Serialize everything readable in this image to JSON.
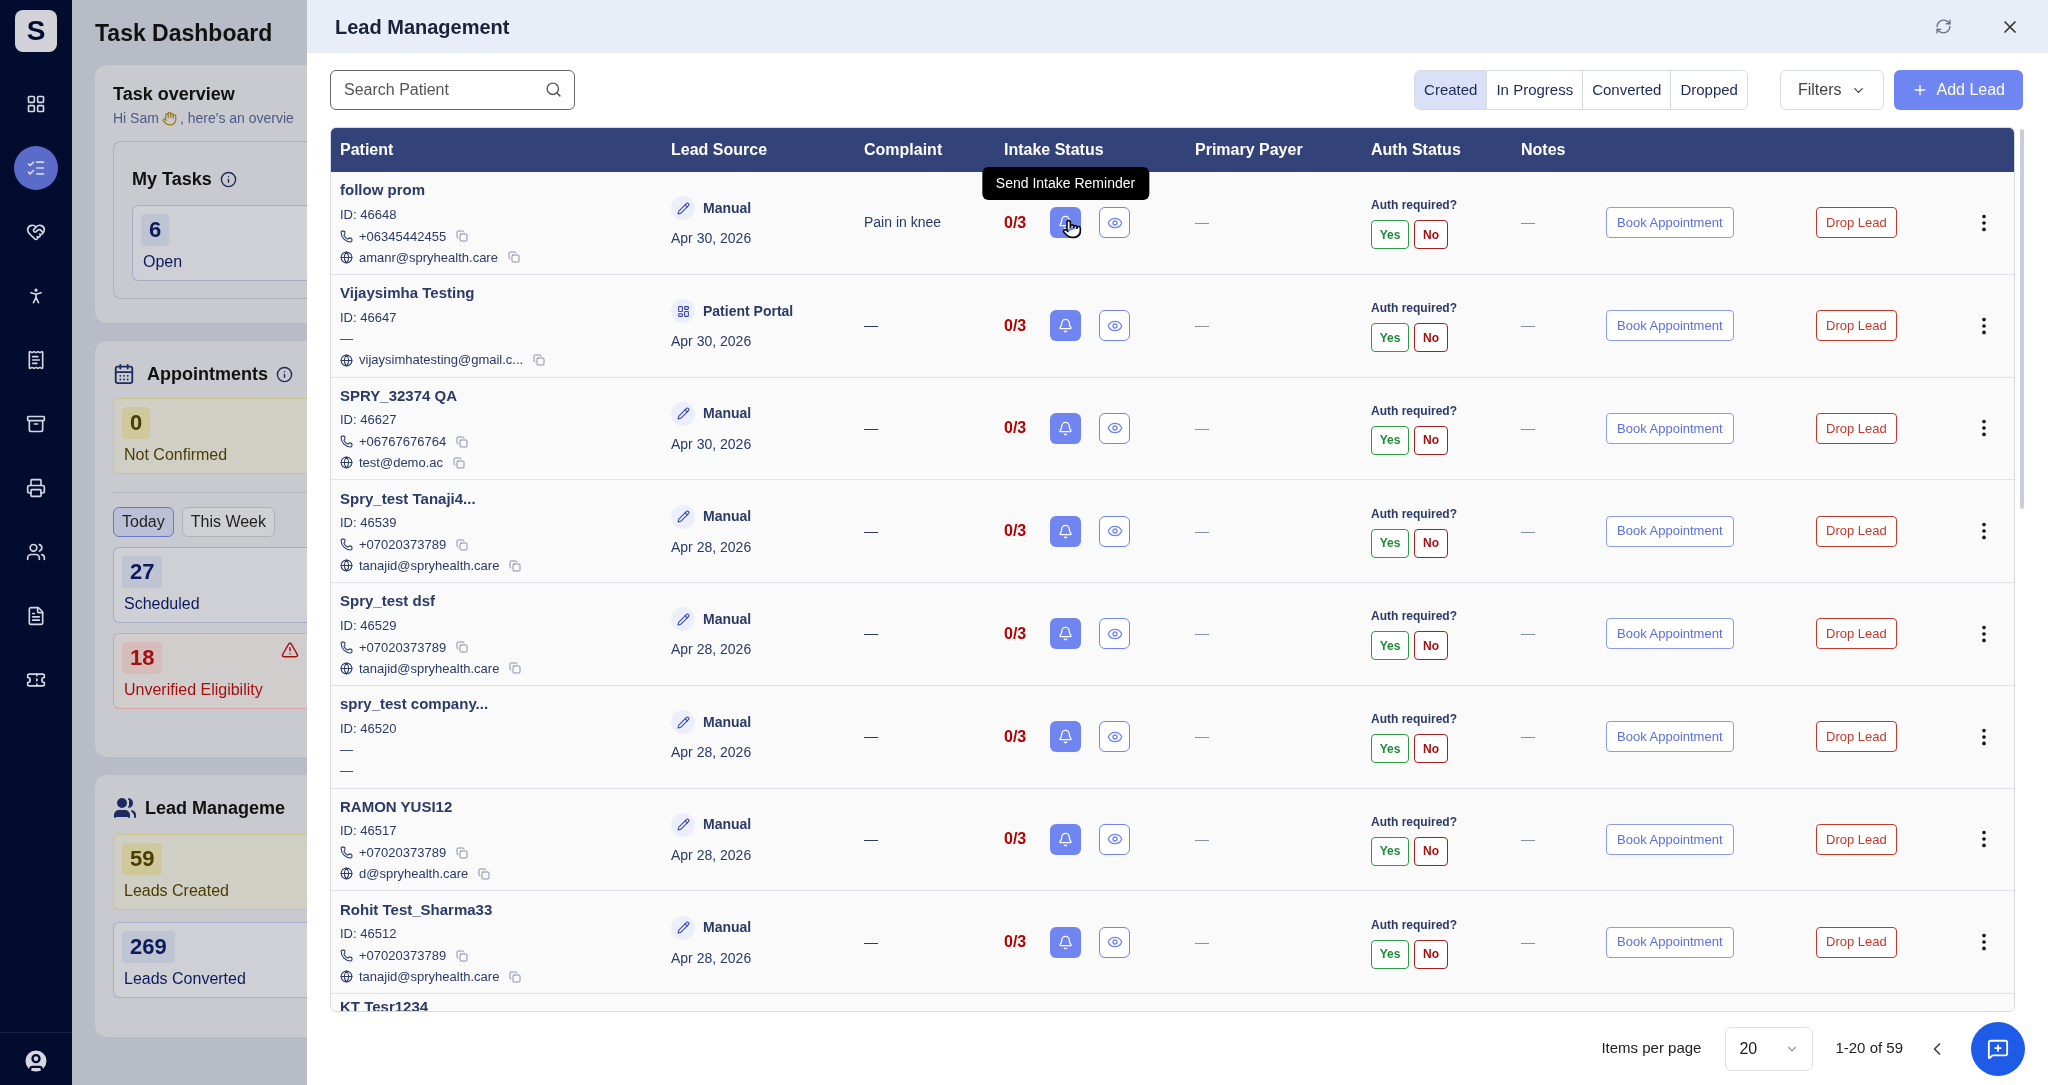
{
  "sidebar": {
    "logo": "S",
    "items": [
      {
        "kind": "grid",
        "selected": false
      },
      {
        "kind": "tasks",
        "selected": true
      },
      {
        "kind": "heart",
        "selected": false
      },
      {
        "kind": "walk",
        "selected": false
      },
      {
        "kind": "billing",
        "selected": false
      },
      {
        "kind": "archive",
        "selected": false
      },
      {
        "kind": "printer",
        "selected": false
      },
      {
        "kind": "referral",
        "selected": false
      },
      {
        "kind": "document",
        "selected": false
      },
      {
        "kind": "ticket",
        "selected": false
      }
    ]
  },
  "dashboard": {
    "title": "Task Dashboard",
    "overview": {
      "title": "Task overview",
      "greeting_before": "Hi Sam",
      "greeting_after": ", here's an overvie"
    },
    "my_tasks": {
      "title": "My Tasks",
      "stats": [
        {
          "value": "6",
          "label": "Open",
          "kind": "info"
        }
      ]
    },
    "appointments": {
      "title": "Appointments",
      "top_stats": [
        {
          "value": "0",
          "label": "Not Confirmed",
          "kind": "warning"
        }
      ],
      "tabs": [
        {
          "label": "Today",
          "selected": true
        },
        {
          "label": "This Week",
          "selected": false
        }
      ],
      "stats": [
        {
          "value": "27",
          "label": "Scheduled",
          "kind": "info"
        },
        {
          "value": "18",
          "label": "Unverified Eligibility",
          "kind": "danger"
        }
      ]
    },
    "leads": {
      "title": "Lead Manageme",
      "stats": [
        {
          "value": "59",
          "label": "Leads Created",
          "kind": "warning"
        },
        {
          "value": "269",
          "label": "Leads Converted",
          "kind": "info"
        }
      ]
    }
  },
  "drawer": {
    "title": "Lead Management",
    "search": {
      "placeholder": "Search Patient"
    },
    "status_tabs": [
      {
        "label": "Created",
        "selected": true
      },
      {
        "label": "In Progress",
        "selected": false
      },
      {
        "label": "Converted",
        "selected": false
      },
      {
        "label": "Dropped",
        "selected": false
      }
    ],
    "filters": "Filters",
    "add_lead": "Add Lead",
    "table": {
      "columns": [
        "Patient",
        "Lead Source",
        "Complaint",
        "Intake Status",
        "Primary Payer",
        "Auth Status",
        "Notes"
      ],
      "rows": [
        {
          "name": "follow prom",
          "id": "ID: 46648",
          "contacts": [
            {
              "kind": "phone",
              "text": "+06345442455"
            },
            {
              "kind": "email",
              "text": "amanr@spryhealth.care"
            }
          ],
          "source": {
            "kind": "manual",
            "label": "Manual"
          },
          "date": "Apr 30, 2026",
          "complaint": "Pain in knee",
          "intake": "0/3",
          "tooltip": "Send Intake Reminder",
          "payer": "—",
          "auth_label": "Auth required?",
          "yes": "Yes",
          "no": "No",
          "notes": "—",
          "book": "Book Appointment",
          "drop": "Drop Lead"
        },
        {
          "name": "Vijaysimha Testing",
          "id": "ID: 46647",
          "contacts": [
            {
              "kind": "none",
              "text": "—"
            },
            {
              "kind": "email",
              "text": "vijaysimhatesting@gmail.c..."
            }
          ],
          "source": {
            "kind": "portal",
            "label": "Patient Portal"
          },
          "date": "Apr 30, 2026",
          "complaint": "—",
          "intake": "0/3",
          "payer": "—",
          "auth_label": "Auth required?",
          "yes": "Yes",
          "no": "No",
          "notes": "—",
          "book": "Book Appointment",
          "drop": "Drop Lead"
        },
        {
          "name": "SPRY_32374 QA",
          "id": "ID: 46627",
          "contacts": [
            {
              "kind": "phone",
              "text": "+06767676764"
            },
            {
              "kind": "email",
              "text": "test@demo.ac"
            }
          ],
          "source": {
            "kind": "manual",
            "label": "Manual"
          },
          "date": "Apr 30, 2026",
          "complaint": "—",
          "intake": "0/3",
          "payer": "—",
          "auth_label": "Auth required?",
          "yes": "Yes",
          "no": "No",
          "notes": "—",
          "book": "Book Appointment",
          "drop": "Drop Lead"
        },
        {
          "name": "Spry_test Tanaji4...",
          "id": "ID: 46539",
          "contacts": [
            {
              "kind": "phone",
              "text": "+07020373789"
            },
            {
              "kind": "email",
              "text": "tanajid@spryhealth.care"
            }
          ],
          "source": {
            "kind": "manual",
            "label": "Manual"
          },
          "date": "Apr 28, 2026",
          "complaint": "—",
          "intake": "0/3",
          "payer": "—",
          "auth_label": "Auth required?",
          "yes": "Yes",
          "no": "No",
          "notes": "—",
          "book": "Book Appointment",
          "drop": "Drop Lead"
        },
        {
          "name": "Spry_test dsf",
          "id": "ID: 46529",
          "contacts": [
            {
              "kind": "phone",
              "text": "+07020373789"
            },
            {
              "kind": "email",
              "text": "tanajid@spryhealth.care"
            }
          ],
          "source": {
            "kind": "manual",
            "label": "Manual"
          },
          "date": "Apr 28, 2026",
          "complaint": "—",
          "intake": "0/3",
          "payer": "—",
          "auth_label": "Auth required?",
          "yes": "Yes",
          "no": "No",
          "notes": "—",
          "book": "Book Appointment",
          "drop": "Drop Lead"
        },
        {
          "name": "spry_test company...",
          "id": "ID: 46520",
          "contacts": [
            {
              "kind": "none",
              "text": "—"
            },
            {
              "kind": "none",
              "text": "—"
            }
          ],
          "source": {
            "kind": "manual",
            "label": "Manual"
          },
          "date": "Apr 28, 2026",
          "complaint": "—",
          "intake": "0/3",
          "payer": "—",
          "auth_label": "Auth required?",
          "yes": "Yes",
          "no": "No",
          "notes": "—",
          "book": "Book Appointment",
          "drop": "Drop Lead"
        },
        {
          "name": "RAMON YUSI12",
          "id": "ID: 46517",
          "contacts": [
            {
              "kind": "phone",
              "text": "+07020373789"
            },
            {
              "kind": "email",
              "text": "d@spryhealth.care"
            }
          ],
          "source": {
            "kind": "manual",
            "label": "Manual"
          },
          "date": "Apr 28, 2026",
          "complaint": "—",
          "intake": "0/3",
          "payer": "—",
          "auth_label": "Auth required?",
          "yes": "Yes",
          "no": "No",
          "notes": "—",
          "book": "Book Appointment",
          "drop": "Drop Lead"
        },
        {
          "name": "Rohit Test_Sharma33",
          "id": "ID: 46512",
          "contacts": [
            {
              "kind": "phone",
              "text": "+07020373789"
            },
            {
              "kind": "email",
              "text": "tanajid@spryhealth.care"
            }
          ],
          "source": {
            "kind": "manual",
            "label": "Manual"
          },
          "date": "Apr 28, 2026",
          "complaint": "—",
          "intake": "0/3",
          "payer": "—",
          "auth_label": "Auth required?",
          "yes": "Yes",
          "no": "No",
          "notes": "—",
          "book": "Book Appointment",
          "drop": "Drop Lead"
        }
      ],
      "cut_row_name": "KT Tesr1234"
    },
    "pagination": {
      "items_label": "Items per page",
      "per_page": "20",
      "range": "1-20 of 59"
    }
  }
}
